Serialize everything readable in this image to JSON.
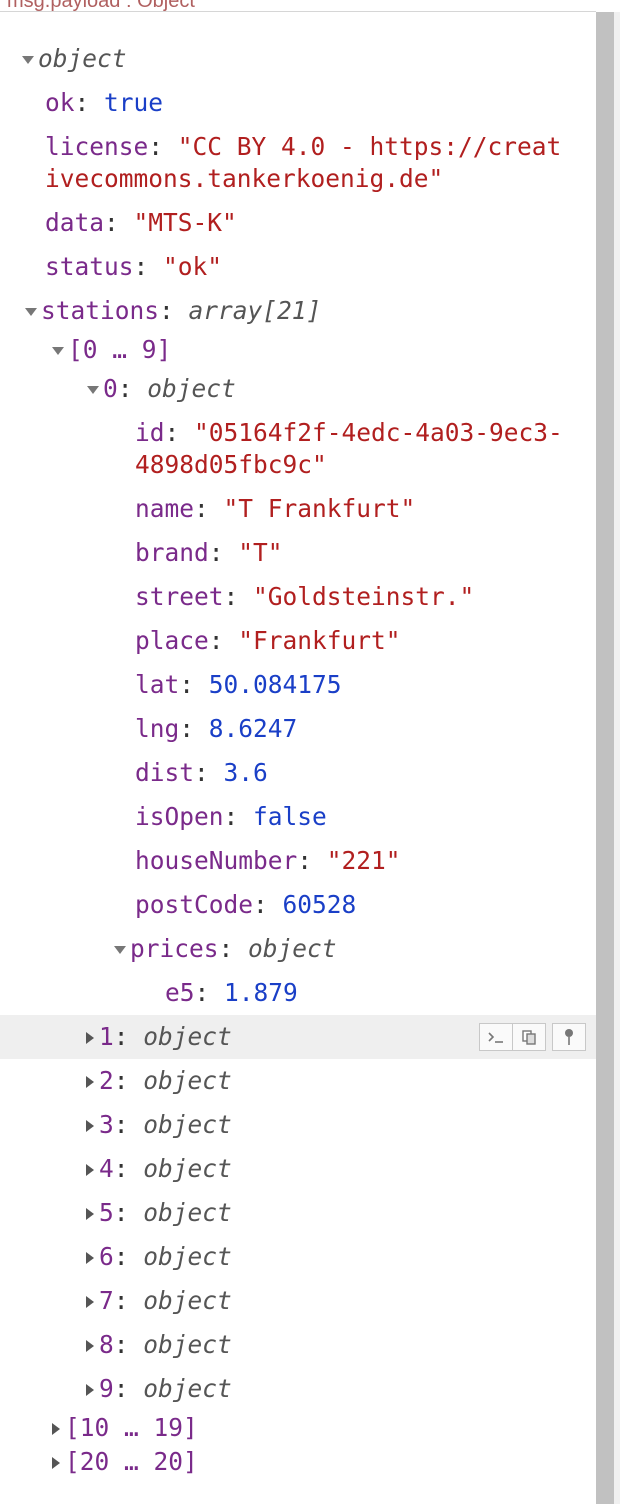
{
  "header": {
    "path_label": "msg.payload : Object"
  },
  "root": {
    "type_label": "object"
  },
  "fields": {
    "ok": {
      "key": "ok",
      "value": "true"
    },
    "license": {
      "key": "license",
      "value": "\"CC BY 4.0 - https://creativecommons.tankerkoenig.de\""
    },
    "data": {
      "key": "data",
      "value": "\"MTS-K\""
    },
    "status": {
      "key": "status",
      "value": "\"ok\""
    },
    "stations": {
      "key": "stations",
      "type_label": "array[21]"
    }
  },
  "ranges": {
    "r0": "[0 … 9]",
    "r1": "[10 … 19]",
    "r2": "[20 … 20]"
  },
  "station0": {
    "index": "0",
    "type_label": "object",
    "id": {
      "key": "id",
      "value": "\"05164f2f-4edc-4a03-9ec3-4898d05fbc9c\""
    },
    "name": {
      "key": "name",
      "value": "\"T Frankfurt\""
    },
    "brand": {
      "key": "brand",
      "value": "\"T\""
    },
    "street": {
      "key": "street",
      "value": "\"Goldsteinstr.\""
    },
    "place": {
      "key": "place",
      "value": "\"Frankfurt\""
    },
    "lat": {
      "key": "lat",
      "value": "50.084175"
    },
    "lng": {
      "key": "lng",
      "value": "8.6247"
    },
    "dist": {
      "key": "dist",
      "value": "3.6"
    },
    "isOpen": {
      "key": "isOpen",
      "value": "false"
    },
    "houseNumber": {
      "key": "houseNumber",
      "value": "\"221\""
    },
    "postCode": {
      "key": "postCode",
      "value": "60528"
    },
    "prices": {
      "key": "prices",
      "type_label": "object"
    },
    "e5": {
      "key": "e5",
      "value": "1.879"
    }
  },
  "collapsed_items": [
    {
      "index": "1",
      "type_label": "object"
    },
    {
      "index": "2",
      "type_label": "object"
    },
    {
      "index": "3",
      "type_label": "object"
    },
    {
      "index": "4",
      "type_label": "object"
    },
    {
      "index": "5",
      "type_label": "object"
    },
    {
      "index": "6",
      "type_label": "object"
    },
    {
      "index": "7",
      "type_label": "object"
    },
    {
      "index": "8",
      "type_label": "object"
    },
    {
      "index": "9",
      "type_label": "object"
    }
  ],
  "toolbar": {
    "icons": [
      "terminal-icon",
      "copy-icon",
      "pin-icon"
    ]
  },
  "colors": {
    "key": "#7a2a8a",
    "string": "#b11f1f",
    "number": "#1a3fc7",
    "highlight": "#efefef"
  }
}
